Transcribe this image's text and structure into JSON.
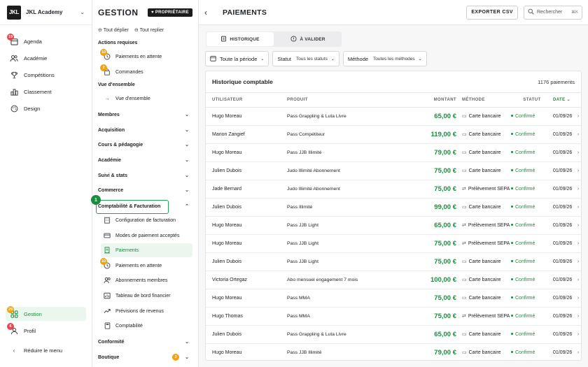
{
  "brand": {
    "name": "JKL Academy",
    "logo_text": "JKL"
  },
  "rail": {
    "items": [
      {
        "label": "Agenda",
        "icon": "calendar-icon",
        "badge": "19",
        "badge_color": "red"
      },
      {
        "label": "Académie",
        "icon": "users-icon"
      },
      {
        "label": "Compétitions",
        "icon": "trophy-icon"
      },
      {
        "label": "Classement",
        "icon": "podium-icon"
      },
      {
        "label": "Design",
        "icon": "palette-icon"
      }
    ],
    "bottom": [
      {
        "label": "Gestion",
        "icon": "grid-icon",
        "badge": "29",
        "badge_color": "orange",
        "active": true
      },
      {
        "label": "Profil",
        "icon": "user-icon",
        "badge": "6",
        "badge_color": "red"
      }
    ],
    "collapse_label": "Réduire le menu"
  },
  "panel": {
    "title": "GESTION",
    "owner_badge": "PROPRIÉTAIRE",
    "expand_all": "Tout déplier",
    "collapse_all": "Tout replier",
    "required_actions": "Actions requises",
    "pending_payments": "Paiements en attente",
    "pending_payments_badge": "10",
    "orders": "Commandes",
    "orders_badge": "2",
    "overview_section": "Vue d'ensemble",
    "overview_item": "Vue d'ensemble",
    "groups": [
      "Membres",
      "Acquisition",
      "Cours & pédagogie",
      "Académie",
      "Suivi & stats",
      "Commerce"
    ],
    "billing_group": "Comptabilité & Facturation",
    "step_marker": "1",
    "billing_items": [
      {
        "label": "Configuration de facturation",
        "icon": "building-icon"
      },
      {
        "label": "Modes de paiement acceptés",
        "icon": "card-icon"
      },
      {
        "label": "Paiements",
        "icon": "receipt-icon",
        "active": true
      },
      {
        "label": "Paiements en attente",
        "icon": "clock-icon",
        "badge": "10"
      },
      {
        "label": "Abonnements membres",
        "icon": "users-icon"
      },
      {
        "label": "Tableau de bord financier",
        "icon": "dashboard-icon"
      },
      {
        "label": "Prévisions de revenus",
        "icon": "trend-icon"
      },
      {
        "label": "Comptabilité",
        "icon": "calculator-icon"
      }
    ],
    "groups_after": [
      "Conformité",
      "Boutique"
    ],
    "boutique_badge": "2"
  },
  "main": {
    "title": "PAIEMENTS",
    "export_label": "EXPORTER CSV",
    "search_placeholder": "Rechercher",
    "search_shortcut": "⌘K",
    "tabs": [
      {
        "label": "HISTORIQUE",
        "active": true
      },
      {
        "label": "À VALIDER"
      }
    ],
    "filters": {
      "period": "Toute la période",
      "status_label": "Statut",
      "status_value": "Tous les statuts",
      "method_label": "Méthode",
      "method_value": "Toutes les méthodes"
    },
    "table_title": "Historique comptable",
    "count": "1176 paiements",
    "columns": [
      "UTILISATEUR",
      "PRODUIT",
      "MONTANT",
      "MÉTHODE",
      "STATUT",
      "DATE"
    ],
    "rows": [
      {
        "user": "Hugo Moreau",
        "product": "Pass Grappling & Luta Livre",
        "amount": "65,00 €",
        "method": "Carte bancaire",
        "method_type": "card",
        "status": "Confirmé",
        "date": "01/09/26"
      },
      {
        "user": "Manon Zangief",
        "product": "Pass Compétiteur",
        "amount": "119,00 €",
        "method": "Carte bancaire",
        "method_type": "card",
        "status": "Confirmé",
        "date": "01/09/26"
      },
      {
        "user": "Hugo Moreau",
        "product": "Pass JJB Illimité",
        "amount": "79,00 €",
        "method": "Carte bancaire",
        "method_type": "card",
        "status": "Confirmé",
        "date": "01/09/26"
      },
      {
        "user": "Julien Dubois",
        "product": "Judo Illimité Abonnement",
        "amount": "75,00 €",
        "method": "Carte bancaire",
        "method_type": "card",
        "status": "Confirmé",
        "date": "01/09/26"
      },
      {
        "user": "Jade Bernard",
        "product": "Judo Illimité Abonnement",
        "amount": "75,00 €",
        "method": "Prélèvement SEPA",
        "method_type": "sepa",
        "status": "Confirmé",
        "date": "01/09/26"
      },
      {
        "user": "Julien Dubois",
        "product": "Pass Illimité",
        "amount": "99,00 €",
        "method": "Carte bancaire",
        "method_type": "card",
        "status": "Confirmé",
        "date": "01/09/26"
      },
      {
        "user": "Hugo Moreau",
        "product": "Pass JJB Light",
        "amount": "65,00 €",
        "method": "Prélèvement SEPA",
        "method_type": "sepa",
        "status": "Confirmé",
        "date": "01/09/26"
      },
      {
        "user": "Hugo Moreau",
        "product": "Pass JJB Light",
        "amount": "75,00 €",
        "method": "Prélèvement SEPA",
        "method_type": "sepa",
        "status": "Confirmé",
        "date": "01/09/26"
      },
      {
        "user": "Julien Dubois",
        "product": "Pass JJB Light",
        "amount": "75,00 €",
        "method": "Carte bancaire",
        "method_type": "card",
        "status": "Confirmé",
        "date": "01/09/26"
      },
      {
        "user": "Victoria Ortegaz",
        "product": "Abo mensuel engagement 7 mois",
        "amount": "100,00 €",
        "method": "Carte bancaire",
        "method_type": "card",
        "status": "Confirmé",
        "date": "01/09/26"
      },
      {
        "user": "Hugo Moreau",
        "product": "Pass MMA",
        "amount": "75,00 €",
        "method": "Carte bancaire",
        "method_type": "card",
        "status": "Confirmé",
        "date": "01/09/26"
      },
      {
        "user": "Hugo Thomas",
        "product": "Pass MMA",
        "amount": "75,00 €",
        "method": "Prélèvement SEPA",
        "method_type": "sepa",
        "status": "Confirmé",
        "date": "01/09/26"
      },
      {
        "user": "Julien Dubois",
        "product": "Pass Grappling & Luta Livre",
        "amount": "65,00 €",
        "method": "Carte bancaire",
        "method_type": "card",
        "status": "Confirmé",
        "date": "01/09/26"
      },
      {
        "user": "Hugo Moreau",
        "product": "Pass JJB Illimité",
        "amount": "79,00 €",
        "method": "Carte bancaire",
        "method_type": "card",
        "status": "Confirmé",
        "date": "01/09/26"
      }
    ]
  },
  "colors": {
    "accent": "#1a8d3e",
    "badge_red": "#e5484d",
    "badge_orange": "#f2a20c"
  }
}
